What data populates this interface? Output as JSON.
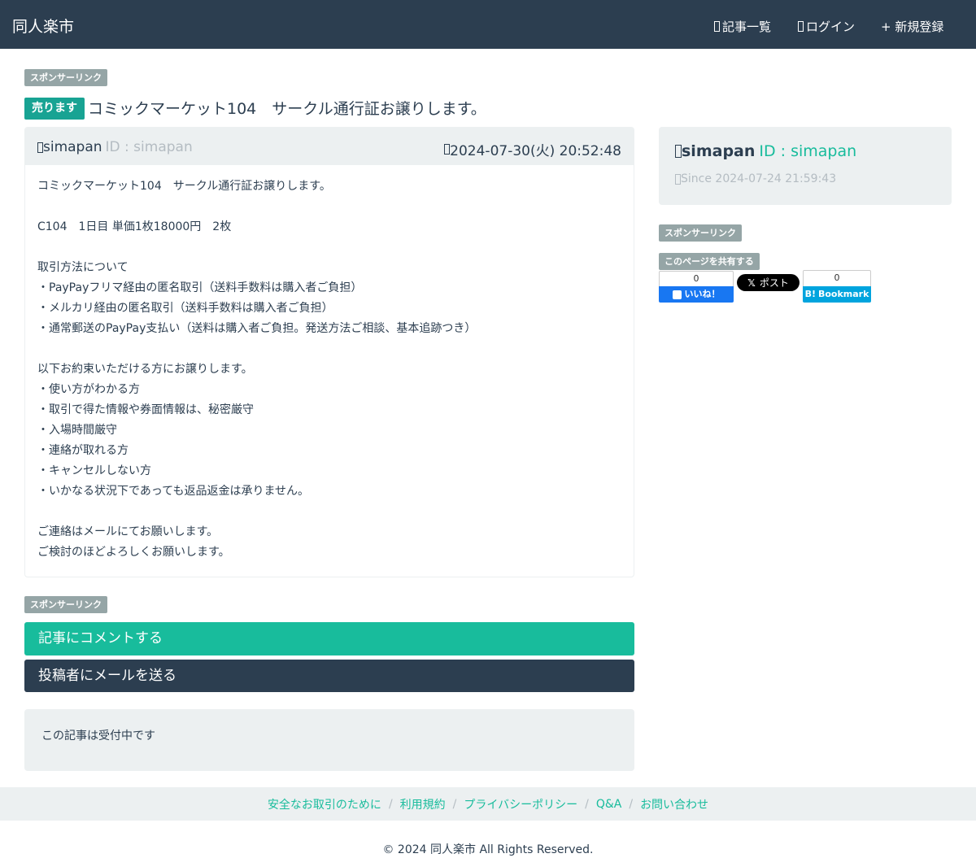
{
  "navbar": {
    "brand": "同人楽市",
    "articles": "記事一覧",
    "login": "ログイン",
    "register": "+ 新規登録"
  },
  "sponsor_label": "スポンサーリンク",
  "post": {
    "type_badge": "売ります",
    "title": "コミックマーケット104　サークル通行証お譲りします。",
    "author_name": "simapan",
    "author_id": "ID : simapan",
    "date": "2024-07-30(火) 20:52:48",
    "body_lines": [
      "コミックマーケット104　サークル通行証お譲りします。",
      "",
      "C104　1日目 単価1枚18000円　2枚",
      "",
      "取引方法について",
      "・PayPayフリマ経由の匿名取引（送料手数料は購入者ご負担）",
      "・メルカリ経由の匿名取引（送料手数料は購入者ご負担）",
      "・通常郵送のPayPay支払い（送料は購入者ご負担。発送方法ご相談、基本追跡つき）",
      "",
      "以下お約束いただける方にお譲りします。",
      "・使い方がわかる方",
      "・取引で得た情報や券面情報は、秘密厳守",
      "・入場時間厳守",
      "・連絡が取れる方",
      "・キャンセルしない方",
      "・いかなる状況下であっても返品返金は承りません。",
      "",
      "ご連絡はメールにてお願いします。",
      "ご検討のほどよろしくお願いします。"
    ]
  },
  "actions": {
    "comment": "記事にコメントする",
    "mail": "投稿者にメールを送る"
  },
  "status": "この記事は受付中です",
  "sidebar": {
    "user_name": "simapan",
    "user_id": "ID : simapan",
    "since": "Since 2024-07-24 21:59:43",
    "share_label": "このページを共有する",
    "fb_count": "0",
    "fb_label": "いいね！",
    "x_label": "ポスト",
    "x_logo": "𝕏",
    "hb_count": "0",
    "hb_logo": "B!",
    "hb_label": "Bookmark"
  },
  "footer": {
    "links": [
      "安全なお取引のために",
      "利用規約",
      "プライバシーポリシー",
      "Q&A",
      "お問い合わせ"
    ],
    "separator": "/",
    "copyright": "© 2024 同人楽市 All Rights Reserved."
  },
  "colors": {
    "navbar": "#2c3e50",
    "accent": "#18bc9c",
    "badge_sell": "#18a393",
    "badge_sponsor": "#95a5a6",
    "well": "#ecf0f1"
  }
}
